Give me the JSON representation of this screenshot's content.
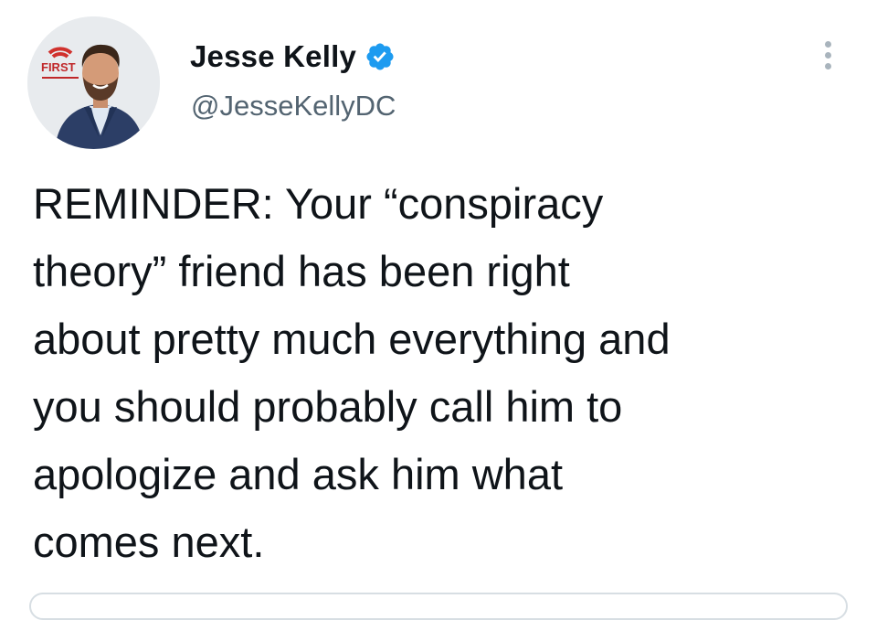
{
  "tweet": {
    "author": {
      "display_name": "Jesse Kelly",
      "handle": "@JesseKellyDC",
      "verified": true,
      "avatar_badge_text": "FIRST"
    },
    "text": "REMINDER: Your “conspiracy theory” friend has been right about pretty much everything and you should probably call him to apologize and ask him what comes next.",
    "text_lines": [
      "REMINDER: Your “conspiracy",
      "theory” friend has been right",
      "about pretty much everything and",
      "you should probably call him to",
      "apologize and ask him what",
      "comes next."
    ]
  },
  "icons": {
    "verified": "verified-badge-icon",
    "more": "more-options-icon"
  },
  "colors": {
    "verified_blue": "#1d9bf0",
    "text_primary": "#0f1419",
    "text_secondary": "#536471",
    "badge_red": "#d0312d"
  }
}
